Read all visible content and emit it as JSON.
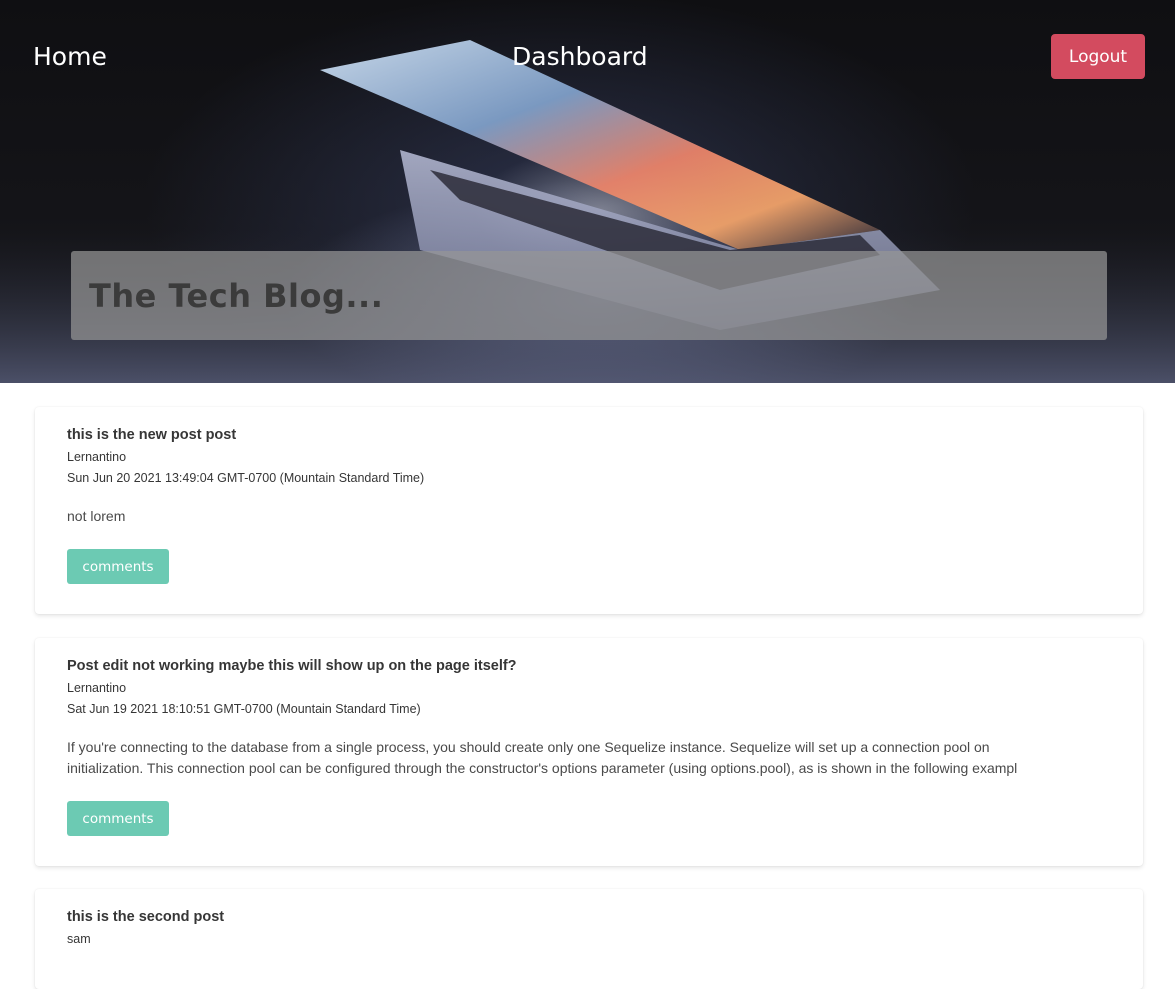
{
  "nav": {
    "home_label": "Home",
    "dashboard_label": "Dashboard",
    "logout_label": "Logout"
  },
  "hero": {
    "title": "The Tech Blog..."
  },
  "posts": [
    {
      "title": "this is the new post post",
      "author": "Lernantino",
      "date": "Sun Jun 20 2021 13:49:04 GMT-0700 (Mountain Standard Time)",
      "body_lines": [
        "not lorem"
      ],
      "comments_label": "comments"
    },
    {
      "title": "Post edit not working maybe this will show up on the page itself?",
      "author": "Lernantino",
      "date": "Sat Jun 19 2021 18:10:51 GMT-0700 (Mountain Standard Time)",
      "body_lines": [
        "If you're connecting to the database from a single process, you should create only one Sequelize instance. Sequelize will set up a connection pool on",
        "initialization. This connection pool can be configured through the constructor's options parameter (using options.pool), as is shown in the following exampl"
      ],
      "comments_label": "comments"
    },
    {
      "title": "this is the second post",
      "author": "sam"
    }
  ],
  "colors": {
    "logout": "#d34b5f",
    "comments_button": "#6ccab3"
  }
}
